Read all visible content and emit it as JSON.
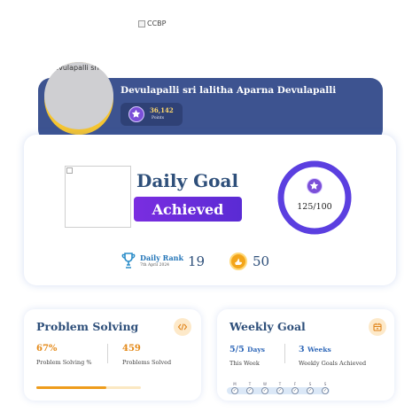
{
  "header": {
    "logo_alt": "CCBP"
  },
  "profile": {
    "avatar_alt": "Devulapalli sri lalitha Aparna Devulapalli",
    "name": "Devulapalli sri lalitha Aparna Devulapalli",
    "points_value": "36,142",
    "points_label": "Points"
  },
  "daily_goal": {
    "title": "Daily Goal",
    "status": "Achieved",
    "progress_text": "125/100",
    "progress_fraction": 1.0,
    "rank_label": "Daily Rank",
    "rank_date": "7th April 2024",
    "rank_value": "19",
    "coins_value": "50"
  },
  "problem_solving": {
    "title": "Problem Solving",
    "percent": "67%",
    "percent_label": "Problem Solving %",
    "solved": "459",
    "solved_label": "Problems Solved",
    "progress_fraction": 0.67
  },
  "weekly_goal": {
    "title": "Weekly Goal",
    "days_value": "5/5",
    "days_unit": "Days",
    "days_label": "This Week",
    "weeks_value": "3",
    "weeks_unit": "Weeks",
    "weeks_label": "Weekly Goals Achieved",
    "day_letters": [
      "M",
      "T",
      "W",
      "T",
      "F",
      "S",
      "S"
    ]
  },
  "colors": {
    "profile_band": "#3d5390",
    "accent_purple": "#6a2fdc",
    "ring_purple": "#5b3fe0",
    "accent_orange": "#ee9c1c",
    "title_navy": "#2e4f7a",
    "rank_blue": "#2576b8"
  },
  "icons": {
    "points": "star-icon",
    "rank": "trophy-icon",
    "coins": "coin-icon",
    "problem_solving": "code-icon",
    "weekly_goal": "calendar-icon"
  }
}
